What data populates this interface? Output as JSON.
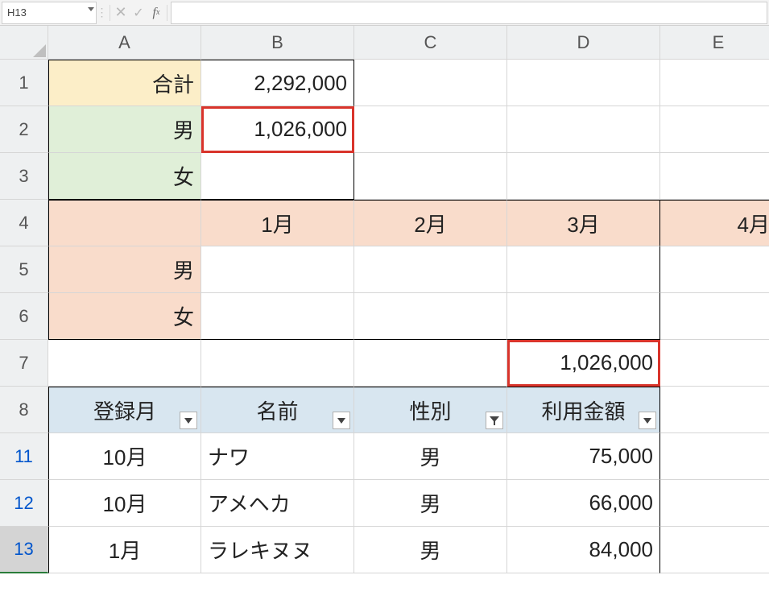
{
  "formula_bar": {
    "cell_ref": "H13",
    "formula": ""
  },
  "col_headers": [
    "A",
    "B",
    "C",
    "D",
    "E"
  ],
  "row_headers": [
    "1",
    "2",
    "3",
    "4",
    "5",
    "6",
    "7",
    "8",
    "11",
    "12",
    "13"
  ],
  "filtered_rows": [
    "11",
    "12",
    "13"
  ],
  "selected_row": "13",
  "summary": {
    "total_label": "合計",
    "total_value": "2,292,000",
    "male_label": "男",
    "male_value": "1,026,000",
    "female_label": "女",
    "female_value": ""
  },
  "months": {
    "header": [
      "1月",
      "2月",
      "3月",
      "4月"
    ],
    "male_label": "男",
    "female_label": "女"
  },
  "d7": "1,026,000",
  "table": {
    "headers": [
      "登録月",
      "名前",
      "性別",
      "利用金額"
    ],
    "filter_active_col": 2,
    "rows": [
      {
        "month": "10月",
        "name": "ナワ",
        "gender": "男",
        "amount": "75,000"
      },
      {
        "month": "10月",
        "name": "アメヘカ",
        "gender": "男",
        "amount": "66,000"
      },
      {
        "month": "1月",
        "name": "ラレキヌヌ",
        "gender": "男",
        "amount": "84,000"
      }
    ]
  }
}
